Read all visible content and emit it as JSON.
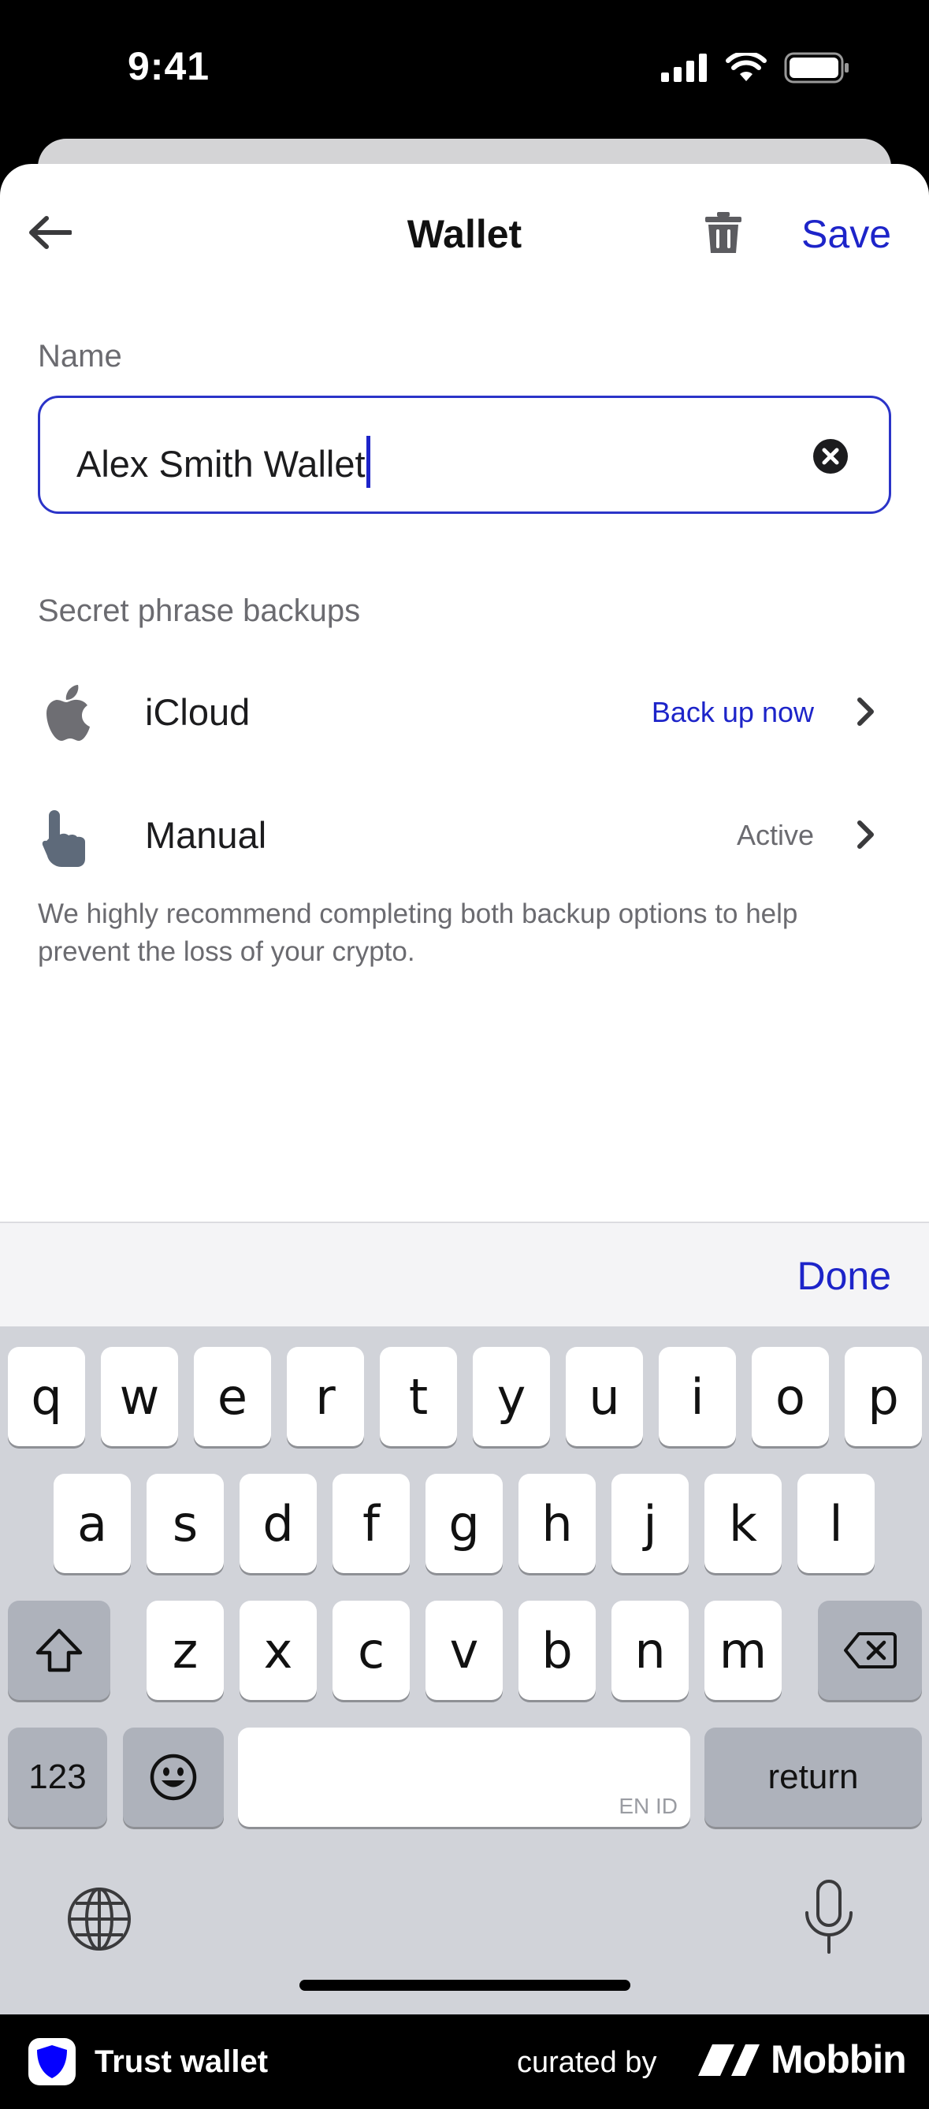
{
  "status_bar": {
    "time": "9:41"
  },
  "header": {
    "title": "Wallet",
    "save_label": "Save"
  },
  "name_section": {
    "label": "Name",
    "value": "Alex Smith Wallet"
  },
  "backups": {
    "label": "Secret phrase backups",
    "items": [
      {
        "title": "iCloud",
        "status": "Back up now",
        "status_color": "#1d24c9",
        "icon": "apple-icon"
      },
      {
        "title": "Manual",
        "status": "Active",
        "status_color": "#6b6b70",
        "icon": "hand-pointer-icon"
      }
    ],
    "help": "We highly recommend completing both backup options to help prevent the loss of your crypto."
  },
  "accessory": {
    "done_label": "Done"
  },
  "keyboard": {
    "row1": [
      "q",
      "w",
      "e",
      "r",
      "t",
      "y",
      "u",
      "i",
      "o",
      "p"
    ],
    "row2": [
      "a",
      "s",
      "d",
      "f",
      "g",
      "h",
      "j",
      "k",
      "l"
    ],
    "row3": [
      "z",
      "x",
      "c",
      "v",
      "b",
      "n",
      "m"
    ],
    "numbers_label": "123",
    "return_label": "return",
    "space_sublabel": "EN ID"
  },
  "footer": {
    "brand": "Trust wallet",
    "curated_by": "curated by",
    "mobbin": "Mobbin"
  },
  "colors": {
    "accent": "#1d24c9",
    "secondary_text": "#6b6b70"
  }
}
